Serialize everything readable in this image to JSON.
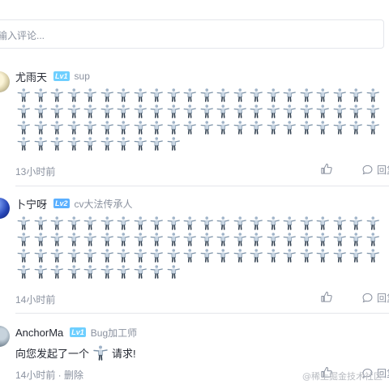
{
  "input": {
    "placeholder": "输入评论..."
  },
  "comments": [
    {
      "user": "尤雨天",
      "level": "Lv1",
      "title": "sup",
      "emoji_count": 76,
      "time": "13小时前",
      "reply_label": "回复"
    },
    {
      "user": "卜宁呀",
      "level": "Lv2",
      "title": "cv大法传承人",
      "emoji_count": 76,
      "time": "14小时前",
      "reply_label": "回复"
    },
    {
      "user": "AnchorMa",
      "level": "Lv1",
      "title": "Bug加工师",
      "text_before": "向您发起了一个",
      "text_after": "请求!",
      "time": "14小时前 · 删除",
      "reply_label": "回复"
    }
  ],
  "watermark": "@稀土掘金技术社区",
  "icons": {
    "like": "thumbs-up-icon",
    "reply": "comment-bubble-icon",
    "emoji": "robot-dance-icon"
  }
}
